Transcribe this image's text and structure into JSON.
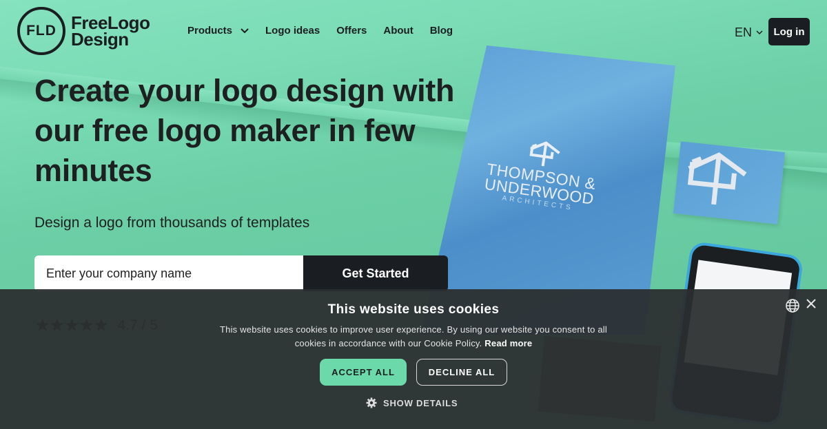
{
  "brand": {
    "mark": "FLD",
    "name_line1": "FreeLogo",
    "name_line2": "Design"
  },
  "nav": {
    "items": [
      {
        "label": "Products",
        "has_dropdown": true
      },
      {
        "label": "Logo ideas"
      },
      {
        "label": "Offers"
      },
      {
        "label": "About"
      },
      {
        "label": "Blog"
      }
    ],
    "language": "EN",
    "login_label": "Log in"
  },
  "hero": {
    "headline_line1": "Create your logo design with",
    "headline_line2": "our free logo maker in few",
    "headline_line3": "minutes",
    "subheadline": "Design a logo from thousands of templates",
    "input_placeholder": "Enter your company name",
    "cta_label": "Get Started",
    "rating": {
      "stars": "★★★★★",
      "score": "4.7 / 5"
    },
    "mockup": {
      "company_line1": "THOMPSON &",
      "company_line2": "UNDERWOOD",
      "company_line3": "ARCHITECTS"
    }
  },
  "cookie_banner": {
    "title": "This website uses cookies",
    "body": "This website uses cookies to improve user experience. By using our website you consent to all cookies in accordance with our Cookie Policy.",
    "read_more": "Read more",
    "accept_label": "ACCEPT ALL",
    "decline_label": "DECLINE ALL",
    "details_label": "SHOW DETAILS"
  },
  "colors": {
    "hero_green": "#6fd3a8",
    "dark": "#1a1d21",
    "accept_green": "#6bd9a9",
    "overlay": "#2c2f30",
    "poster_blue": "#5d9fd6"
  }
}
